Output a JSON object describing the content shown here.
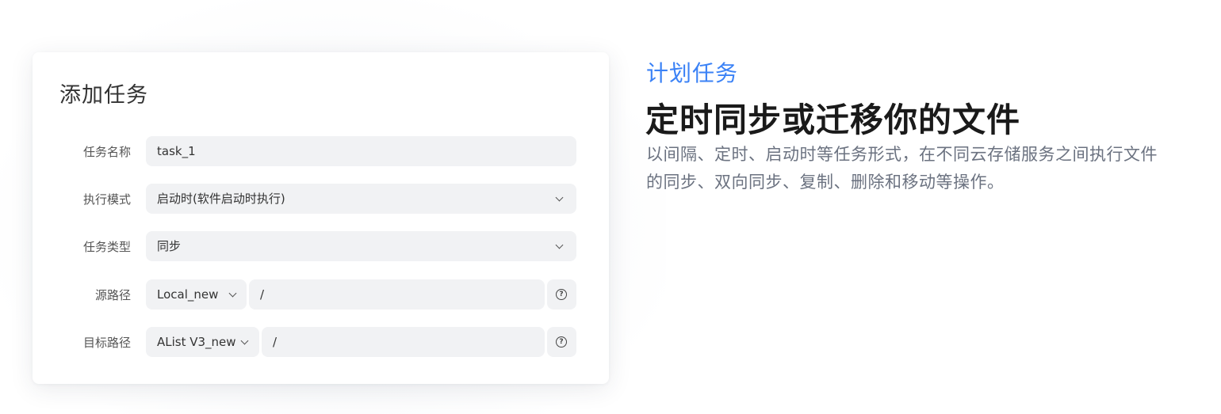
{
  "card": {
    "title": "添加任务",
    "fields": {
      "task_name": {
        "label": "任务名称",
        "value": "task_1"
      },
      "exec_mode": {
        "label": "执行模式",
        "value": "启动时(软件启动时执行)"
      },
      "task_type": {
        "label": "任务类型",
        "value": "同步"
      },
      "source": {
        "label": "源路径",
        "storage": "Local_new",
        "path": "/"
      },
      "target": {
        "label": "目标路径",
        "storage": "AList V3_new",
        "path": "/"
      }
    },
    "help_glyph": "?"
  },
  "hero": {
    "subtitle": "计划任务",
    "title": "定时同步或迁移你的文件",
    "desc_line1": "以间隔、定时、启动时等任务形式，在不同云存储服务之间执行文件",
    "desc_line2": "的同步、双向同步、复制、删除和移动等操作。"
  },
  "colors": {
    "accent": "#3b82f6",
    "field_bg": "#f1f2f4"
  }
}
